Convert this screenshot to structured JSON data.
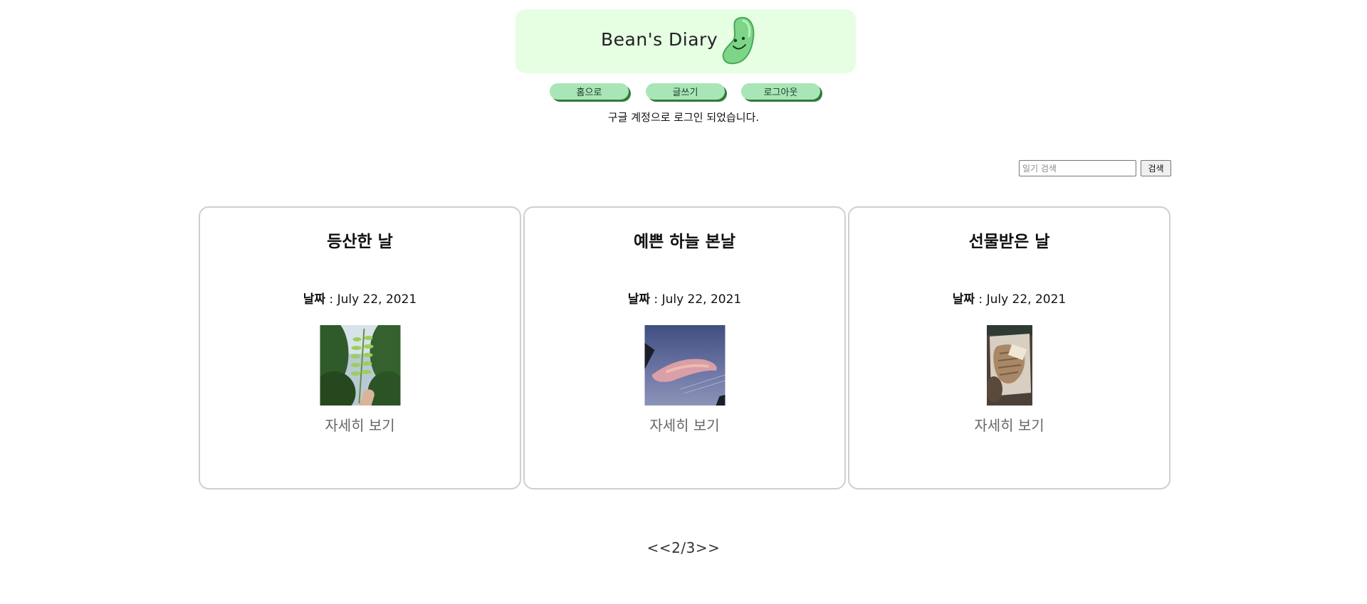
{
  "header": {
    "title": "Bean's Diary",
    "logo_icon": "bean-smiley-icon",
    "background": "#e6ffe3"
  },
  "nav": {
    "home_label": "홈으로",
    "write_label": "글쓰기",
    "logout_label": "로그아웃",
    "button_color": "#a8e6b8",
    "shadow_color": "#2f7a3c"
  },
  "login_status": "구글 계정으로 로그인 되었습니다.",
  "search": {
    "placeholder": "일기 검색",
    "value": "",
    "button_label": "검색"
  },
  "cards": [
    {
      "title": "등산한 날",
      "date_label": "날짜",
      "date_value": " : July 22, 2021",
      "link": "자세히 보기",
      "photo": "leaf-branch-photo"
    },
    {
      "title": "예쁜 하늘 본날",
      "date_label": "날짜",
      "date_value": " : July 22, 2021",
      "link": "자세히 보기",
      "photo": "sunset-sky-photo"
    },
    {
      "title": "선물받은 날",
      "date_label": "날짜",
      "date_value": " : July 22, 2021",
      "link": "자세히 보기",
      "photo": "gift-box-photo"
    }
  ],
  "pagination": {
    "prev": "<<",
    "current": "2",
    "separator": "/",
    "total": "3",
    "next": ">>"
  }
}
